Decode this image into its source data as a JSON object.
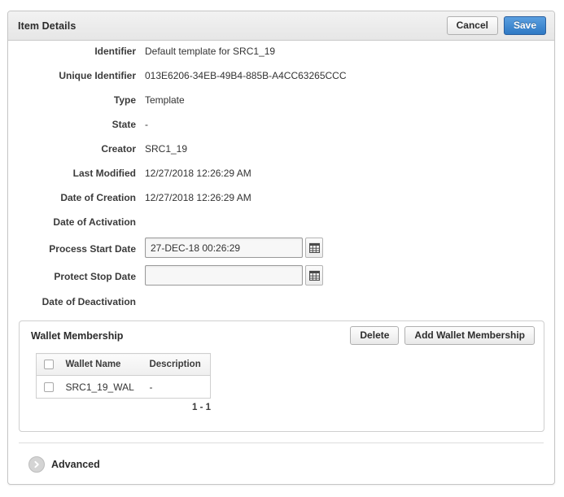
{
  "window": {
    "title": "Item Details",
    "cancel_label": "Cancel",
    "save_label": "Save"
  },
  "details": {
    "fields": [
      {
        "label": "Identifier",
        "value": "Default template for SRC1_19"
      },
      {
        "label": "Unique Identifier",
        "value": "013E6206-34EB-49B4-885B-A4CC63265CCC"
      },
      {
        "label": "Type",
        "value": "Template"
      },
      {
        "label": "State",
        "value": "-"
      },
      {
        "label": "Creator",
        "value": "SRC1_19"
      },
      {
        "label": "Last Modified",
        "value": "12/27/2018 12:26:29 AM"
      },
      {
        "label": "Date of Creation",
        "value": "12/27/2018 12:26:29 AM"
      },
      {
        "label": "Date of Activation",
        "value": ""
      }
    ],
    "date_fields": [
      {
        "label": "Process Start Date",
        "value": "27-DEC-18 00:26:29",
        "placeholder": "",
        "icon": "calendar-icon"
      },
      {
        "label": "Protect Stop Date",
        "value": "",
        "placeholder": "",
        "icon": "calendar-icon"
      }
    ],
    "trailing_field": {
      "label": "Date of Deactivation",
      "value": ""
    }
  },
  "wallet_panel": {
    "title": "Wallet Membership",
    "delete_label": "Delete",
    "add_label": "Add Wallet Membership",
    "table": {
      "columns": [
        "",
        "Wallet Name",
        "Description"
      ],
      "rows": [
        {
          "checked": false,
          "wallet_name": "SRC1_19_WAL",
          "description": "-"
        }
      ]
    },
    "pager_text": "1 - 1"
  },
  "advanced": {
    "label": "Advanced",
    "icon": "chevron-right-circle-icon",
    "expanded": false
  },
  "colors": {
    "accent": "#2f79c4",
    "titlebar_top": "#f2f2f2",
    "titlebar_bottom": "#e6e6e6",
    "border": "#c6c6c6",
    "text": "#333333"
  }
}
